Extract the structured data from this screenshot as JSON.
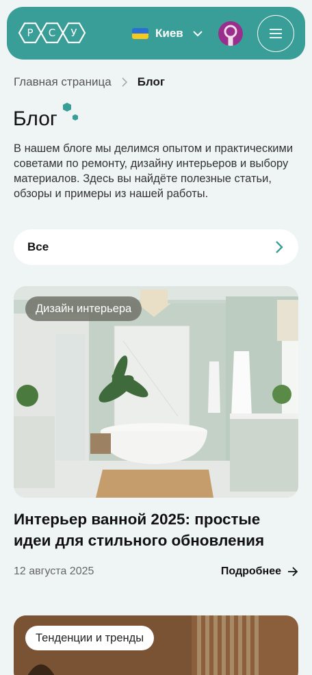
{
  "header": {
    "logo_letters": [
      "Р",
      "С",
      "У"
    ],
    "city": "Киев",
    "colors": {
      "brand": "#3a9e98",
      "avatar": "#9a2e8c"
    }
  },
  "breadcrumb": {
    "home": "Главная страница",
    "current": "Блог"
  },
  "page": {
    "title": "Блог",
    "intro": "В нашем блоге мы делимся опытом и практическими советами по ремонту, дизайну интерьеров и выбору материалов. Здесь вы найдёте полезные статьи, обзоры и примеры из нашей работы."
  },
  "filter": {
    "label": "Все"
  },
  "posts": [
    {
      "tag": "Дизайн интерьера",
      "title": "Интерьер ванной 2025: простые идеи для стильного обновления",
      "date": "12 августа 2025",
      "more": "Подробнее"
    },
    {
      "tag": "Тенденции и тренды"
    }
  ]
}
